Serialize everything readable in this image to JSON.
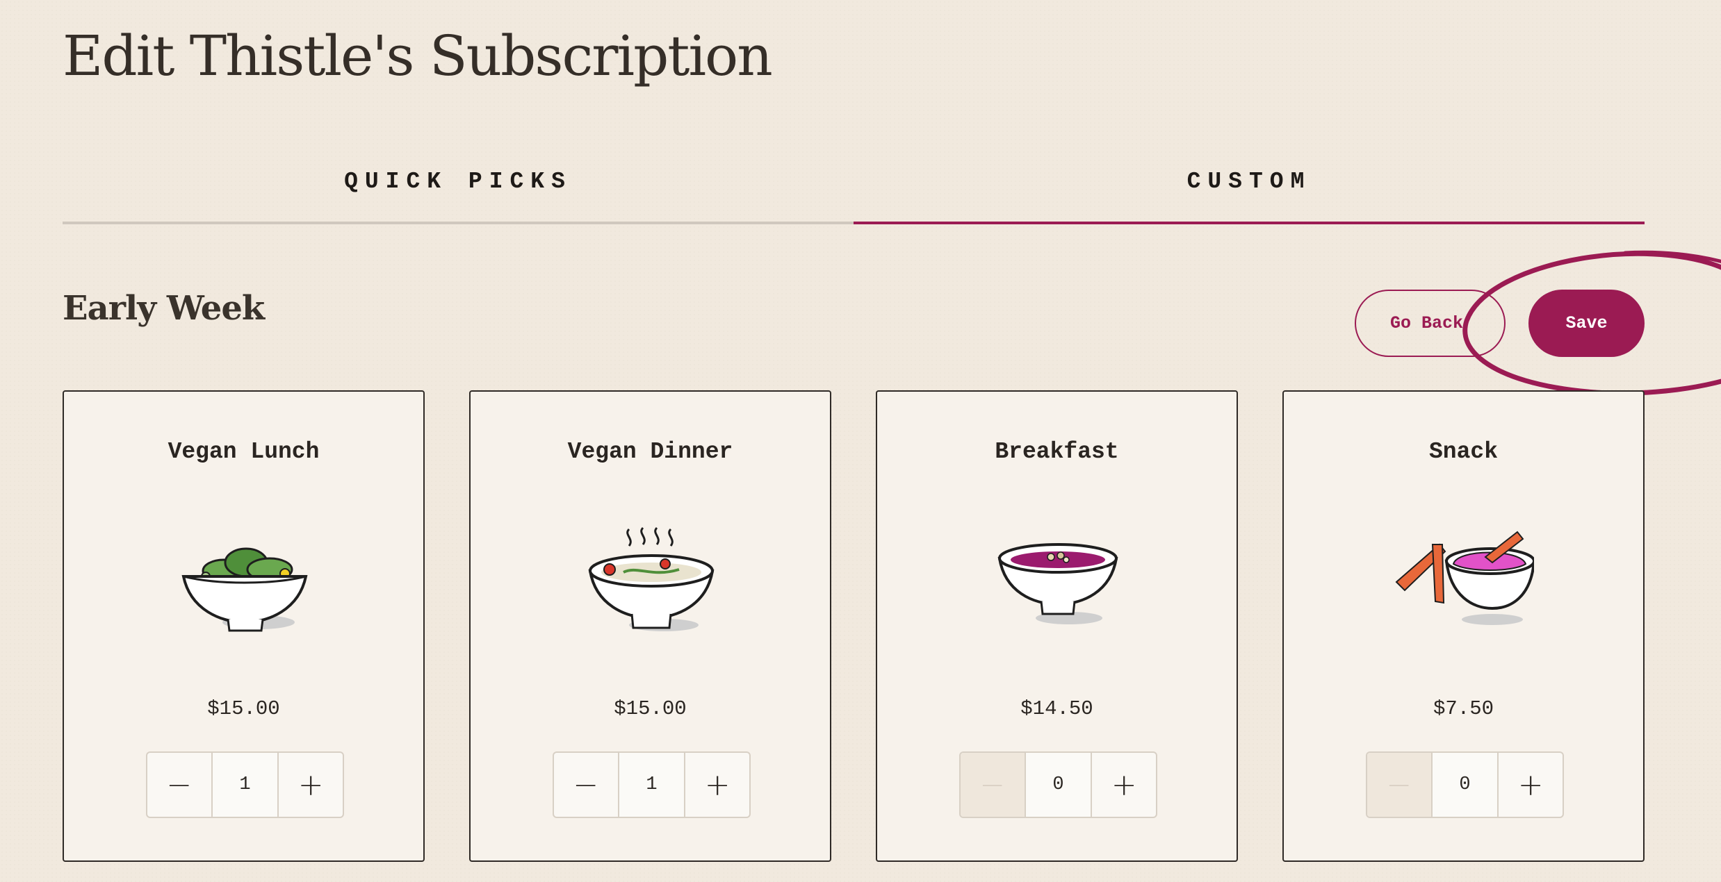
{
  "page": {
    "title": "Edit Thistle's Subscription"
  },
  "tabs": [
    {
      "label": "QUICK PICKS",
      "active": false
    },
    {
      "label": "CUSTOM",
      "active": true
    }
  ],
  "section": {
    "title": "Early Week"
  },
  "actions": {
    "back_label": "Go Back",
    "save_label": "Save"
  },
  "colors": {
    "accent": "#9b1b53",
    "background": "#f1e9de",
    "card": "#f7f2eb"
  },
  "meals": [
    {
      "name": "Vegan Lunch",
      "price": "$15.00",
      "quantity": "1",
      "icon": "salad-bowl-icon"
    },
    {
      "name": "Vegan Dinner",
      "price": "$15.00",
      "quantity": "1",
      "icon": "soup-bowl-icon"
    },
    {
      "name": "Breakfast",
      "price": "$14.50",
      "quantity": "0",
      "icon": "smoothie-bowl-icon"
    },
    {
      "name": "Snack",
      "price": "$7.50",
      "quantity": "0",
      "icon": "dip-bowl-icon"
    }
  ]
}
